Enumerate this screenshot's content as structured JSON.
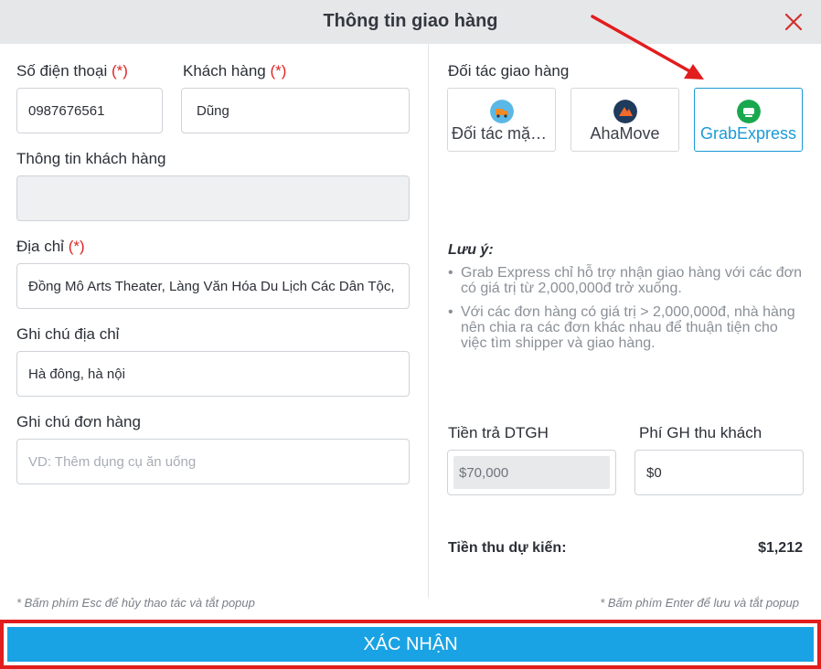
{
  "header": {
    "title": "Thông tin giao hàng",
    "close_icon": "close-icon"
  },
  "form": {
    "phone": {
      "label": "Số điện thoại",
      "required_mark": "(*)",
      "value": "0987676561"
    },
    "customer": {
      "label": "Khách hàng",
      "required_mark": "(*)",
      "value": "Dũng"
    },
    "customer_info": {
      "label": "Thông tin khách hàng",
      "value": ""
    },
    "address": {
      "label": "Địa chỉ",
      "required_mark": "(*)",
      "value": "Đồng Mô Arts Theater, Làng Văn Hóa Du Lịch Các Dân Tộc, Việt Nam"
    },
    "address_note": {
      "label": "Ghi chú địa chỉ",
      "value": "Hà đông, hà nội"
    },
    "order_note": {
      "label": "Ghi chú đơn hàng",
      "placeholder": "VD: Thêm dụng cụ ăn uống"
    }
  },
  "partners": {
    "label": "Đối tác giao hàng",
    "items": [
      {
        "name": "Đối tác mặc định",
        "short": "Đối tác mặc…",
        "icon": "delivery-truck-icon",
        "color": "#5bb8e6",
        "selected": false
      },
      {
        "name": "AhaMove",
        "short": "AhaMove",
        "icon": "ahamove-logo-icon",
        "color": "#1f3b5c",
        "selected": false
      },
      {
        "name": "GrabExpress",
        "short": "GrabExpress",
        "icon": "grab-logo-icon",
        "color": "#1aa84f",
        "selected": true
      }
    ]
  },
  "note": {
    "title": "Lưu ý:",
    "items": [
      "Grab Express chỉ hỗ trợ nhận giao hàng với các đơn có giá trị từ 2,000,000đ trở xuống.",
      "Với các đơn hàng có giá trị > 2,000,000đ, nhà hàng nên chia ra các đơn khác nhau để thuận tiện cho việc tìm shipper và giao hàng."
    ]
  },
  "fees": {
    "partner_fee": {
      "label": "Tiền trả DTGH",
      "value": "$70,000"
    },
    "customer_fee": {
      "label": "Phí GH thu khách",
      "value": "$0"
    }
  },
  "summary": {
    "label": "Tiền thu dự kiến:",
    "value": "$1,212"
  },
  "hints": {
    "esc": "* Bấm phím Esc để hủy thao tác và tắt popup",
    "enter": "* Bấm phím Enter để lưu và tắt popup"
  },
  "confirm_label": "XÁC NHẬN",
  "colors": {
    "accent": "#1aa3e4",
    "required": "#e02424",
    "highlight": "#e11d1d"
  }
}
